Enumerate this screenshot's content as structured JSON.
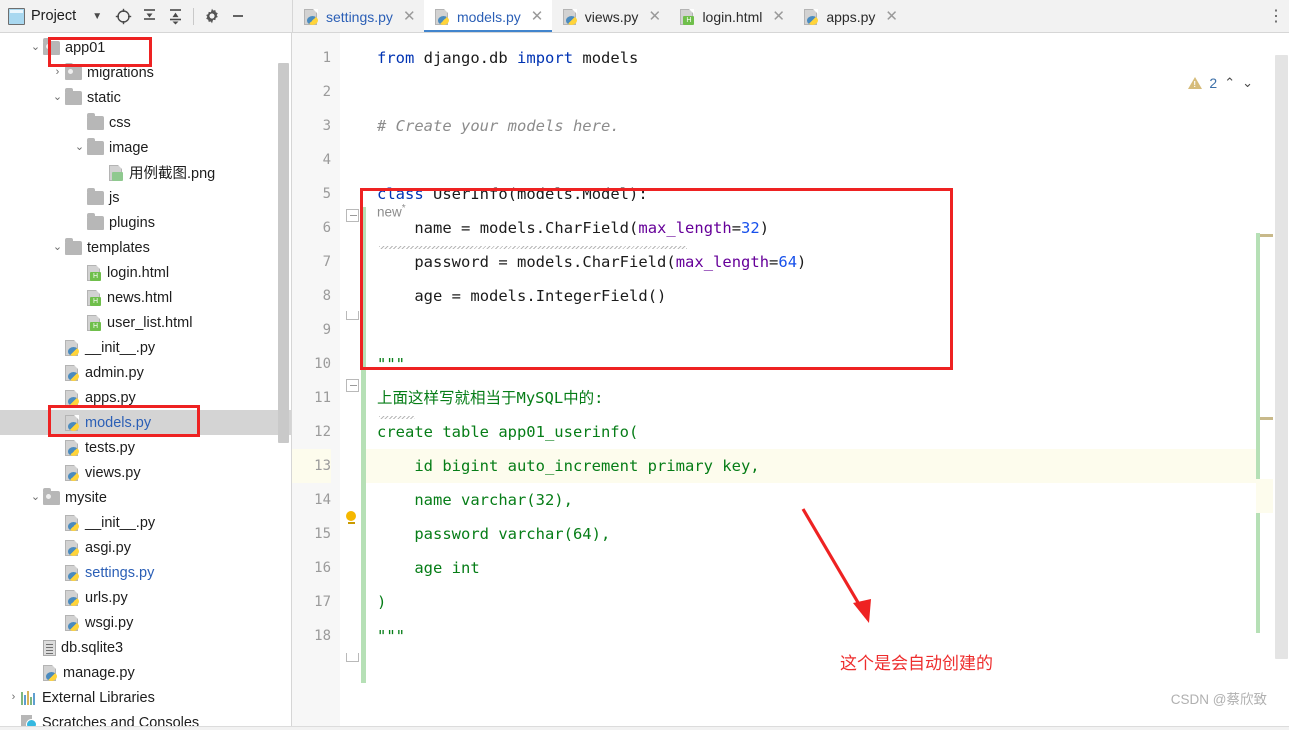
{
  "toolbar": {
    "project_label": "Project",
    "icons": [
      {
        "name": "project-view-icon",
        "glyph": "▦"
      },
      {
        "name": "chevron-down-icon",
        "glyph": "▾"
      },
      {
        "name": "select-opened-file-icon",
        "glyph": "⊕"
      },
      {
        "name": "expand-all-icon",
        "glyph": "⤓"
      },
      {
        "name": "collapse-all-icon",
        "glyph": "⤒"
      },
      {
        "name": "gear-icon",
        "glyph": "⚙"
      },
      {
        "name": "hide-icon",
        "glyph": "—"
      }
    ]
  },
  "tabs": [
    {
      "label": "settings.py",
      "type": "py",
      "active": false,
      "blue": true,
      "close": "✕"
    },
    {
      "label": "models.py",
      "type": "py",
      "active": true,
      "blue": true,
      "close": "✕"
    },
    {
      "label": "views.py",
      "type": "py",
      "active": false,
      "blue": false,
      "close": "✕"
    },
    {
      "label": "login.html",
      "type": "html",
      "active": false,
      "blue": false,
      "close": "✕"
    },
    {
      "label": "apps.py",
      "type": "py",
      "active": false,
      "blue": false,
      "close": "✕"
    }
  ],
  "tab_overflow_glyph": "⋮",
  "tree": [
    {
      "label": "app01",
      "indent": 1,
      "twisty": "⌄",
      "icon": "folder-module",
      "selected": false,
      "blue": false
    },
    {
      "label": "migrations",
      "indent": 2,
      "twisty": "›",
      "icon": "folder-module",
      "selected": false,
      "blue": false
    },
    {
      "label": "static",
      "indent": 2,
      "twisty": "⌄",
      "icon": "folder",
      "selected": false,
      "blue": false
    },
    {
      "label": "css",
      "indent": 3,
      "twisty": "",
      "icon": "folder",
      "selected": false,
      "blue": false
    },
    {
      "label": "image",
      "indent": 3,
      "twisty": "⌄",
      "icon": "folder",
      "selected": false,
      "blue": false
    },
    {
      "label": "用例截图.png",
      "indent": 4,
      "twisty": "",
      "icon": "png",
      "selected": false,
      "blue": false
    },
    {
      "label": "js",
      "indent": 3,
      "twisty": "",
      "icon": "folder",
      "selected": false,
      "blue": false
    },
    {
      "label": "plugins",
      "indent": 3,
      "twisty": "",
      "icon": "folder",
      "selected": false,
      "blue": false
    },
    {
      "label": "templates",
      "indent": 2,
      "twisty": "⌄",
      "icon": "folder",
      "selected": false,
      "blue": false
    },
    {
      "label": "login.html",
      "indent": 3,
      "twisty": "",
      "icon": "html",
      "selected": false,
      "blue": false
    },
    {
      "label": "news.html",
      "indent": 3,
      "twisty": "",
      "icon": "html",
      "selected": false,
      "blue": false
    },
    {
      "label": "user_list.html",
      "indent": 3,
      "twisty": "",
      "icon": "html",
      "selected": false,
      "blue": false
    },
    {
      "label": "__init__.py",
      "indent": 2,
      "twisty": "",
      "icon": "py",
      "selected": false,
      "blue": false
    },
    {
      "label": "admin.py",
      "indent": 2,
      "twisty": "",
      "icon": "py",
      "selected": false,
      "blue": false
    },
    {
      "label": "apps.py",
      "indent": 2,
      "twisty": "",
      "icon": "py",
      "selected": false,
      "blue": false
    },
    {
      "label": "models.py",
      "indent": 2,
      "twisty": "",
      "icon": "py",
      "selected": true,
      "blue": true
    },
    {
      "label": "tests.py",
      "indent": 2,
      "twisty": "",
      "icon": "py",
      "selected": false,
      "blue": false
    },
    {
      "label": "views.py",
      "indent": 2,
      "twisty": "",
      "icon": "py",
      "selected": false,
      "blue": false
    },
    {
      "label": "mysite",
      "indent": 1,
      "twisty": "⌄",
      "icon": "folder-module",
      "selected": false,
      "blue": false
    },
    {
      "label": "__init__.py",
      "indent": 2,
      "twisty": "",
      "icon": "py",
      "selected": false,
      "blue": false
    },
    {
      "label": "asgi.py",
      "indent": 2,
      "twisty": "",
      "icon": "py",
      "selected": false,
      "blue": false
    },
    {
      "label": "settings.py",
      "indent": 2,
      "twisty": "",
      "icon": "py",
      "selected": false,
      "blue": true
    },
    {
      "label": "urls.py",
      "indent": 2,
      "twisty": "",
      "icon": "py",
      "selected": false,
      "blue": false
    },
    {
      "label": "wsgi.py",
      "indent": 2,
      "twisty": "",
      "icon": "py",
      "selected": false,
      "blue": false
    },
    {
      "label": "db.sqlite3",
      "indent": 1,
      "twisty": "",
      "icon": "db",
      "selected": false,
      "blue": false
    },
    {
      "label": "manage.py",
      "indent": 1,
      "twisty": "",
      "icon": "py",
      "selected": false,
      "blue": false
    },
    {
      "label": "External Libraries",
      "indent": 0,
      "twisty": "›",
      "icon": "bars",
      "selected": false,
      "blue": false
    },
    {
      "label": "Scratches and Consoles",
      "indent": 0,
      "twisty": "",
      "icon": "scratch",
      "selected": false,
      "blue": false
    }
  ],
  "editor": {
    "line_numbers": [
      "1",
      "2",
      "3",
      "4",
      "5",
      "6",
      "7",
      "8",
      "9",
      "10",
      "11",
      "12",
      "13",
      "14",
      "15",
      "16",
      "17",
      "18"
    ],
    "inline_hint": "new",
    "inline_hint_sup": "*",
    "warning_count": "2",
    "warn_up_glyph": "⌃",
    "warn_down_glyph": "⌄",
    "lines": [
      {
        "n": "1",
        "text": "from django.db import models"
      },
      {
        "n": "2",
        "text": ""
      },
      {
        "n": "3",
        "text": "# Create your models here."
      },
      {
        "n": "4",
        "text": ""
      },
      {
        "n": "5",
        "text": "class UserInfo(models.Model):"
      },
      {
        "n": "6",
        "text": "    name = models.CharField(max_length=32)"
      },
      {
        "n": "7",
        "text": "    password = models.CharField(max_length=64)"
      },
      {
        "n": "8",
        "text": "    age = models.IntegerField()"
      },
      {
        "n": "9",
        "text": ""
      },
      {
        "n": "10",
        "text": "\"\"\""
      },
      {
        "n": "11",
        "text": "上面这样写就相当于MySQL中的:"
      },
      {
        "n": "12",
        "text": "create table app01_userinfo("
      },
      {
        "n": "13",
        "text": "    id bigint auto_increment primary key,"
      },
      {
        "n": "14",
        "text": "    name varchar(32),"
      },
      {
        "n": "15",
        "text": "    password varchar(64),"
      },
      {
        "n": "16",
        "text": "    age int"
      },
      {
        "n": "17",
        "text": ")"
      },
      {
        "n": "18",
        "text": "\"\"\""
      }
    ]
  },
  "annotations": {
    "note_text": "这个是会自动创建的",
    "red_color": "#ee2222"
  },
  "watermark": "CSDN @蔡欣致"
}
